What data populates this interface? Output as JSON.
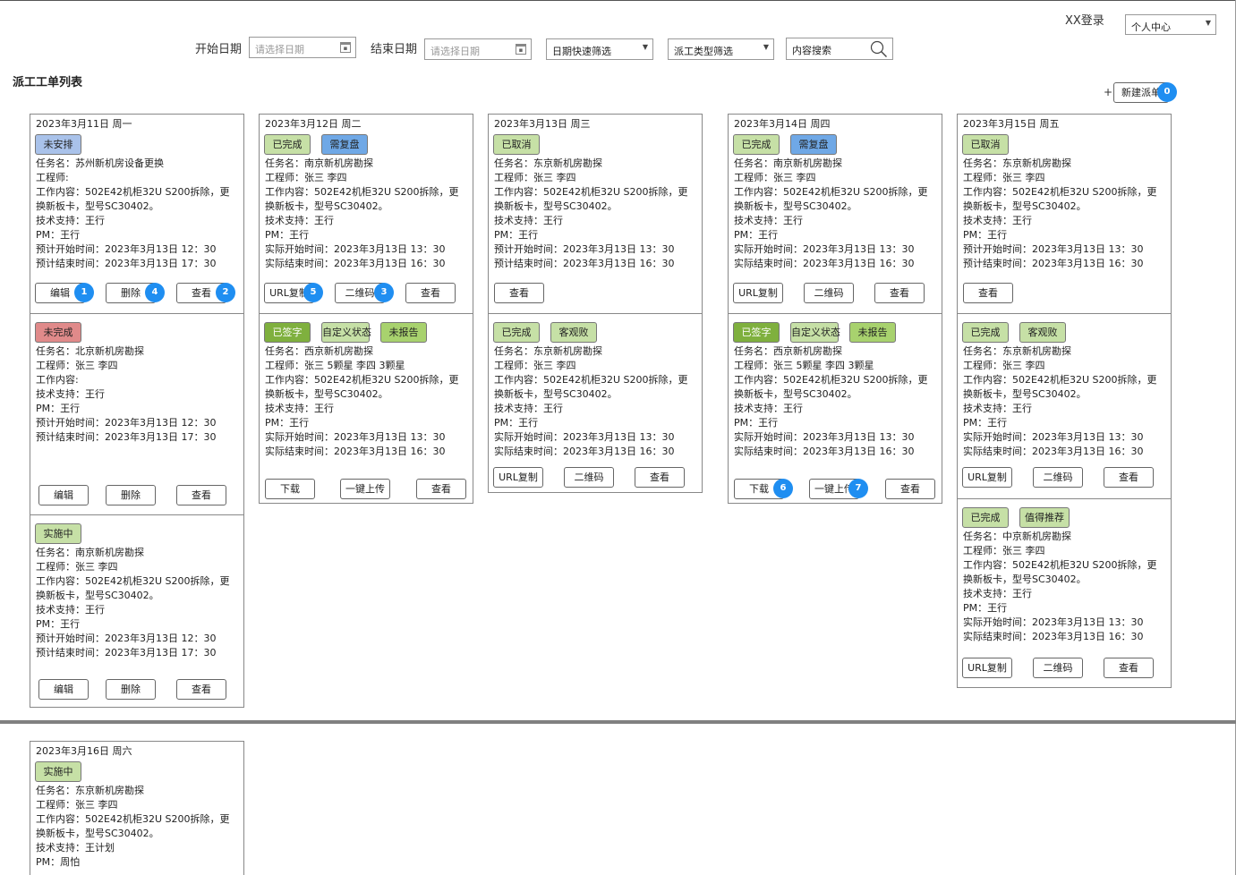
{
  "header": {
    "login_text": "XX登录",
    "user_menu": "个人中心",
    "start_date_label": "开始日期",
    "start_date_placeholder": "请选择日期",
    "end_date_label": "结束日期",
    "end_date_placeholder": "请选择日期",
    "date_quick_filter": "日期快速筛选",
    "dispatch_type_filter": "派工类型筛选",
    "search_placeholder": "内容搜索"
  },
  "page": {
    "title": "派工工单列表",
    "plus": "+",
    "new_button": "新建派单"
  },
  "markers": [
    "0",
    "1",
    "2",
    "3",
    "4",
    "5",
    "6",
    "7"
  ],
  "colors": {
    "green": "#c6e0a6",
    "dark_green": "#7fb03e",
    "mid_green": "#a8d26e",
    "blue": "#6fa8e6",
    "light_blue": "#a9c2ea",
    "red": "#e08a8a",
    "marker": "#1f8ef1"
  },
  "columns": [
    {
      "date": "2023年3月11日 周一",
      "cards": [
        {
          "badges": [
            "未安排"
          ],
          "lines": [
            "任务名：苏州新机房设备更换",
            "工程师:",
            "工作内容：502E42机柜32U S200拆除，更换新板卡，型号SC30402。",
            "技术支持：王行",
            "PM：王行",
            "预计开始时间：2023年3月13日 12：30",
            "预计结束时间：2023年3月13日 17：30"
          ],
          "buttons": [
            "编辑",
            "删除",
            "查看"
          ]
        },
        {
          "badges": [
            "未完成"
          ],
          "lines": [
            "任务名：北京新机房勘探",
            "工程师：张三 李四",
            "工作内容:",
            "技术支持：王行",
            "PM：王行",
            "预计开始时间：2023年3月13日 12：30",
            "预计结束时间：2023年3月13日 17：30"
          ],
          "buttons": [
            "编辑",
            "删除",
            "查看"
          ]
        },
        {
          "badges": [
            "实施中"
          ],
          "lines": [
            "任务名：南京新机房勘探",
            "工程师：张三 李四",
            "工作内容：502E42机柜32U S200拆除，更换新板卡，型号SC30402。",
            "技术支持：王行",
            "PM：王行",
            "预计开始时间：2023年3月13日 12：30",
            "预计结束时间：2023年3月13日 17：30"
          ],
          "buttons": [
            "编辑",
            "删除",
            "查看"
          ]
        }
      ]
    },
    {
      "date": "2023年3月12日 周二",
      "cards": [
        {
          "badges": [
            "已完成",
            "需复盘"
          ],
          "lines": [
            "任务名：南京新机房勘探",
            "工程师：张三 李四",
            "工作内容：502E42机柜32U S200拆除，更换新板卡，型号SC30402。",
            "技术支持：王行",
            "PM：王行",
            "实际开始时间：2023年3月13日 13：30",
            "实际结束时间：2023年3月13日 16：30"
          ],
          "buttons": [
            "URL复制",
            "二维码",
            "查看"
          ]
        },
        {
          "badges": [
            "已签字",
            "自定义状态",
            "未报告"
          ],
          "lines": [
            "任务名：西京新机房勘探",
            "工程师：张三 5颗星 李四 3颗星",
            "工作内容：502E42机柜32U S200拆除，更换新板卡，型号SC30402。",
            "技术支持：王行",
            "PM：王行",
            "实际开始时间：2023年3月13日 13：30",
            "实际结束时间：2023年3月13日 16：30"
          ],
          "buttons": [
            "下载",
            "一键上传",
            "查看"
          ]
        }
      ]
    },
    {
      "date": "2023年3月13日 周三",
      "cards": [
        {
          "badges": [
            "已取消"
          ],
          "lines": [
            "任务名：东京新机房勘探",
            "工程师：张三 李四",
            "工作内容：502E42机柜32U S200拆除，更换新板卡，型号SC30402。",
            "技术支持：王行",
            "PM：王行",
            "预计开始时间：2023年3月13日 13：30",
            "预计结束时间：2023年3月13日 16：30"
          ],
          "buttons": [
            "查看"
          ]
        },
        {
          "badges": [
            "已完成",
            "客观败"
          ],
          "lines": [
            "任务名：东京新机房勘探",
            "工程师：张三 李四",
            "工作内容：502E42机柜32U S200拆除，更换新板卡，型号SC30402。",
            "技术支持：王行",
            "PM：王行",
            "实际开始时间：2023年3月13日 13：30",
            "实际结束时间：2023年3月13日 16：30"
          ],
          "buttons": [
            "URL复制",
            "二维码",
            "查看"
          ]
        }
      ]
    },
    {
      "date": "2023年3月14日 周四",
      "cards": [
        {
          "badges": [
            "已完成",
            "需复盘"
          ],
          "lines": [
            "任务名：南京新机房勘探",
            "工程师：张三 李四",
            "工作内容：502E42机柜32U S200拆除，更换新板卡，型号SC30402。",
            "技术支持：王行",
            "PM：王行",
            "实际开始时间：2023年3月13日 13：30",
            "实际结束时间：2023年3月13日 16：30"
          ],
          "buttons": [
            "URL复制",
            "二维码",
            "查看"
          ]
        },
        {
          "badges": [
            "已签字",
            "自定义状态",
            "未报告"
          ],
          "lines": [
            "任务名：西京新机房勘探",
            "工程师：张三 5颗星 李四 3颗星",
            "工作内容：502E42机柜32U S200拆除，更换新板卡，型号SC30402。",
            "技术支持：王行",
            "PM：王行",
            "实际开始时间：2023年3月13日 13：30",
            "实际结束时间：2023年3月13日 16：30"
          ],
          "buttons": [
            "下载",
            "一键上传",
            "查看"
          ]
        }
      ]
    },
    {
      "date": "2023年3月15日 周五",
      "cards": [
        {
          "badges": [
            "已取消"
          ],
          "lines": [
            "任务名：东京新机房勘探",
            "工程师：张三 李四",
            "工作内容：502E42机柜32U S200拆除，更换新板卡，型号SC30402。",
            "技术支持：王行",
            "PM：王行",
            "预计开始时间：2023年3月13日 13：30",
            "预计结束时间：2023年3月13日 16：30"
          ],
          "buttons": [
            "查看"
          ]
        },
        {
          "badges": [
            "已完成",
            "客观败"
          ],
          "lines": [
            "任务名：东京新机房勘探",
            "工程师：张三 李四",
            "工作内容：502E42机柜32U S200拆除，更换新板卡，型号SC30402。",
            "技术支持：王行",
            "PM：王行",
            "实际开始时间：2023年3月13日 13：30",
            "实际结束时间：2023年3月13日 16：30"
          ],
          "buttons": [
            "URL复制",
            "二维码",
            "查看"
          ]
        },
        {
          "badges": [
            "已完成",
            "值得推荐"
          ],
          "lines": [
            "任务名：中京新机房勘探",
            "工程师：张三 李四",
            "工作内容：502E42机柜32U S200拆除，更换新板卡，型号SC30402。",
            "技术支持：王行",
            "PM：王行",
            "实际开始时间：2023年3月13日 13：30",
            "实际结束时间：2023年3月13日 16：30"
          ],
          "buttons": [
            "URL复制",
            "二维码",
            "查看"
          ]
        }
      ]
    },
    {
      "date": "2023年3月16日 周六",
      "cards": [
        {
          "badges": [
            "实施中"
          ],
          "lines": [
            "任务名：东京新机房勘探",
            "工程师：张三 李四",
            "工作内容：502E42机柜32U S200拆除，更换新板卡，型号SC30402。",
            "技术支持：王计划",
            "PM：周怕"
          ],
          "buttons": []
        }
      ]
    }
  ]
}
